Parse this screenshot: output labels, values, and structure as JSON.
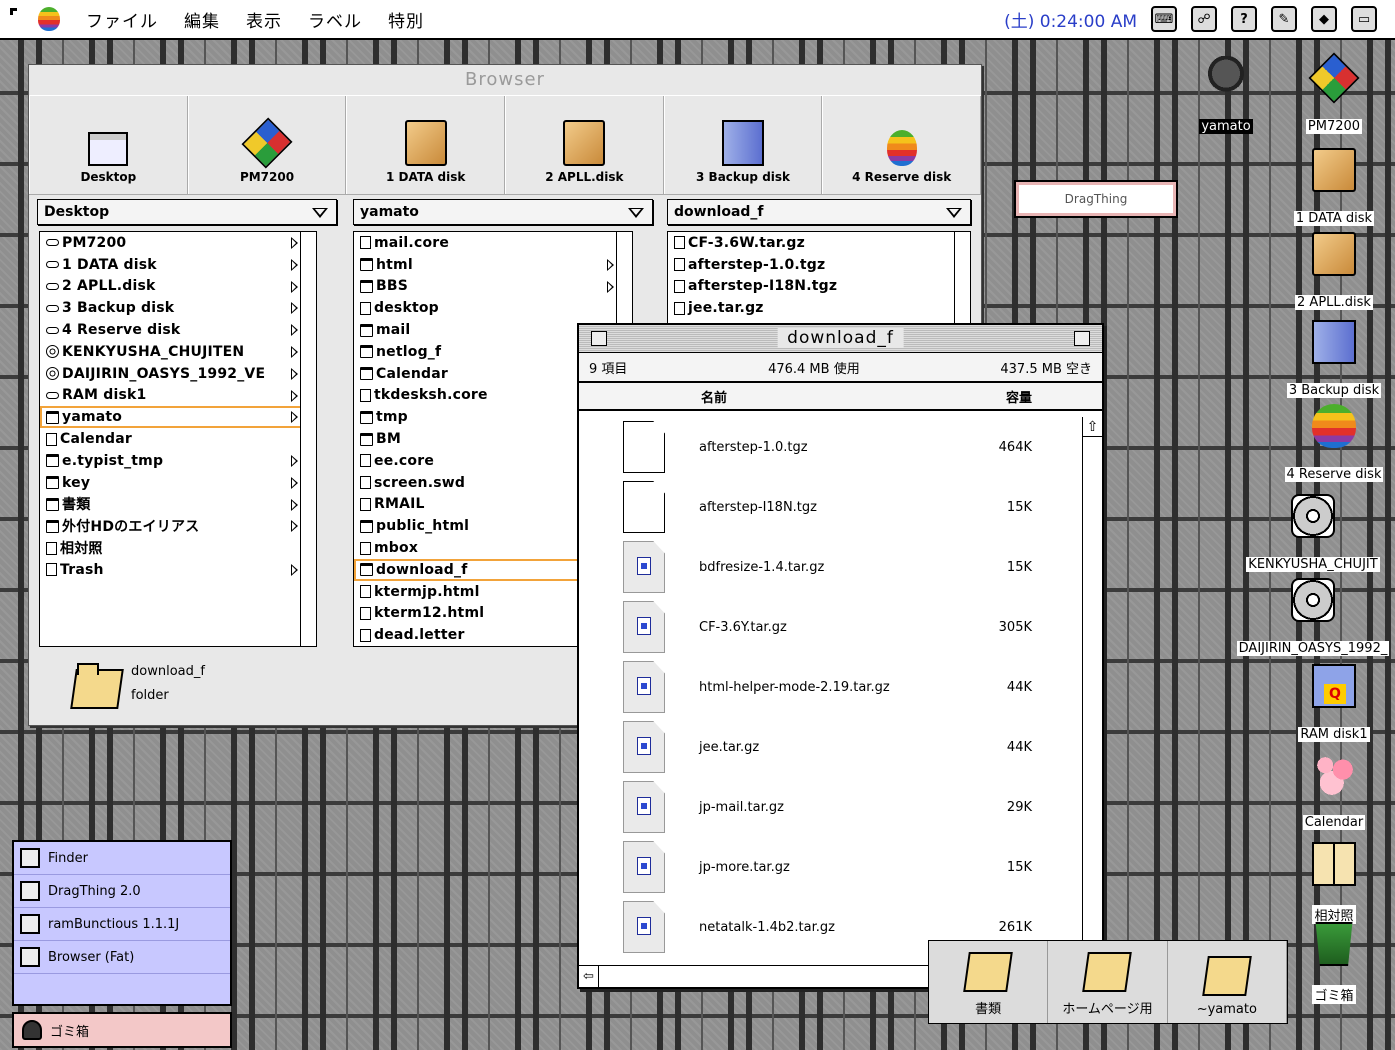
{
  "menubar": {
    "items": [
      "ファイル",
      "編集",
      "表示",
      "ラベル",
      "特別"
    ],
    "clock": "(土) 0:24:00 AM",
    "tray": [
      "icon1",
      "icon2",
      "help",
      "pen",
      "app",
      "window"
    ]
  },
  "browser": {
    "title": "Browser",
    "toolbar": [
      {
        "label": "Desktop",
        "icon": "window-icon"
      },
      {
        "label": "PM7200",
        "icon": "cube-icon"
      },
      {
        "label": "1 DATA disk",
        "icon": "box-icon"
      },
      {
        "label": "2 APLL.disk",
        "icon": "box-icon"
      },
      {
        "label": "3 Backup disk",
        "icon": "server-icon"
      },
      {
        "label": "4 Reserve disk",
        "icon": "apple-icon"
      }
    ],
    "columns": [
      {
        "header": "Desktop",
        "rows": [
          {
            "label": "PM7200",
            "icon": "disk",
            "sub": true
          },
          {
            "label": "1 DATA disk",
            "icon": "disk",
            "sub": true
          },
          {
            "label": "2 APLL.disk",
            "icon": "disk",
            "sub": true
          },
          {
            "label": "3 Backup disk",
            "icon": "disk",
            "sub": true
          },
          {
            "label": "4 Reserve disk",
            "icon": "disk",
            "sub": true
          },
          {
            "label": "KENKYUSHA_CHUJITEN",
            "icon": "cd",
            "sub": true
          },
          {
            "label": "DAIJIRIN_OASYS_1992_VE",
            "icon": "cd",
            "sub": true
          },
          {
            "label": "RAM disk1",
            "icon": "disk",
            "sub": true
          },
          {
            "label": "yamato",
            "icon": "folder",
            "sub": true,
            "selected": true
          },
          {
            "label": "Calendar",
            "icon": "file",
            "sub": false
          },
          {
            "label": "e.typist_tmp",
            "icon": "folder",
            "sub": true
          },
          {
            "label": "key",
            "icon": "folder",
            "sub": true
          },
          {
            "label": "書類",
            "icon": "folder",
            "sub": true
          },
          {
            "label": "外付HDのエイリアス",
            "icon": "folder",
            "sub": true
          },
          {
            "label": "相対照",
            "icon": "file",
            "sub": false
          },
          {
            "label": "Trash",
            "icon": "file",
            "sub": true
          }
        ]
      },
      {
        "header": "yamato",
        "rows": [
          {
            "label": "mail.core",
            "icon": "file",
            "sub": false
          },
          {
            "label": "html",
            "icon": "folder",
            "sub": true
          },
          {
            "label": "BBS",
            "icon": "folder",
            "sub": true
          },
          {
            "label": "desktop",
            "icon": "file",
            "sub": false
          },
          {
            "label": "mail",
            "icon": "folder",
            "sub": false
          },
          {
            "label": "netlog_f",
            "icon": "folder",
            "sub": false
          },
          {
            "label": "Calendar",
            "icon": "folder",
            "sub": false
          },
          {
            "label": "tkdesksh.core",
            "icon": "file",
            "sub": false
          },
          {
            "label": "tmp",
            "icon": "folder",
            "sub": false
          },
          {
            "label": "BM",
            "icon": "folder",
            "sub": false
          },
          {
            "label": "ee.core",
            "icon": "file",
            "sub": false
          },
          {
            "label": "screen.swd",
            "icon": "file",
            "sub": false
          },
          {
            "label": "RMAIL",
            "icon": "file",
            "sub": false
          },
          {
            "label": "public_html",
            "icon": "folder",
            "sub": false
          },
          {
            "label": "mbox",
            "icon": "file",
            "sub": false
          },
          {
            "label": "download_f",
            "icon": "folder",
            "sub": false,
            "selected": true
          },
          {
            "label": "ktermjp.html",
            "icon": "file",
            "sub": false
          },
          {
            "label": "kterm12.html",
            "icon": "file",
            "sub": false
          },
          {
            "label": "dead.letter",
            "icon": "file",
            "sub": false
          }
        ]
      },
      {
        "header": "download_f",
        "rows": [
          {
            "label": "CF-3.6W.tar.gz",
            "icon": "file",
            "sub": false
          },
          {
            "label": "afterstep-1.0.tgz",
            "icon": "file",
            "sub": false
          },
          {
            "label": "afterstep-I18N.tgz",
            "icon": "file",
            "sub": false
          },
          {
            "label": "jee.tar.gz",
            "icon": "file",
            "sub": false
          }
        ]
      }
    ],
    "footer": {
      "name": "download_f",
      "kind": "folder"
    }
  },
  "download_window": {
    "title": "download_f",
    "items_count": "9 項目",
    "used": "476.4 MB 使用",
    "free": "437.5 MB 空き",
    "col_name": "名前",
    "col_size": "容量",
    "files": [
      {
        "name": "afterstep-1.0.tgz",
        "size": "464K",
        "type": "plain"
      },
      {
        "name": "afterstep-I18N.tgz",
        "size": "15K",
        "type": "plain"
      },
      {
        "name": "bdfresize-1.4.tar.gz",
        "size": "15K",
        "type": "gz"
      },
      {
        "name": "CF-3.6Y.tar.gz",
        "size": "305K",
        "type": "gz"
      },
      {
        "name": "html-helper-mode-2.19.tar.gz",
        "size": "44K",
        "type": "gz"
      },
      {
        "name": "jee.tar.gz",
        "size": "44K",
        "type": "gz"
      },
      {
        "name": "jp-mail.tar.gz",
        "size": "29K",
        "type": "gz"
      },
      {
        "name": "jp-more.tar.gz",
        "size": "15K",
        "type": "gz"
      },
      {
        "name": "netatalk-1.4b2.tar.gz",
        "size": "261K",
        "type": "gz"
      }
    ]
  },
  "dragthing_button": "DragThing",
  "desktop_icons": [
    {
      "label": "yamato",
      "icon": "head-icon",
      "inverted": true
    },
    {
      "label": "PM7200",
      "icon": "cube-icon"
    },
    {
      "label": "1 DATA disk",
      "icon": "box-icon"
    },
    {
      "label": "2 APLL.disk",
      "icon": "box-icon"
    },
    {
      "label": "3 Backup disk",
      "icon": "server-icon"
    },
    {
      "label": "4 Reserve disk",
      "icon": "apple-icon"
    },
    {
      "label": "KENKYUSHA_CHUJIT",
      "icon": "cd-icon"
    },
    {
      "label": "DAIJIRIN_OASYS_1992_",
      "icon": "cd-icon"
    },
    {
      "label": "RAM disk1",
      "icon": "floppy-icon"
    },
    {
      "label": "Calendar",
      "icon": "flower-icon"
    },
    {
      "label": "相対照",
      "icon": "book-icon"
    },
    {
      "label": "ゴミ箱",
      "icon": "trash-icon"
    }
  ],
  "app_switcher": [
    {
      "label": "Finder"
    },
    {
      "label": "DragThing 2.0"
    },
    {
      "label": "ramBunctious 1.1.1J"
    },
    {
      "label": "Browser (Fat)"
    }
  ],
  "trash_bar": "ゴミ箱",
  "dock": [
    {
      "label": "書類"
    },
    {
      "label": "ホームページ用"
    },
    {
      "label": "~yamato"
    }
  ]
}
